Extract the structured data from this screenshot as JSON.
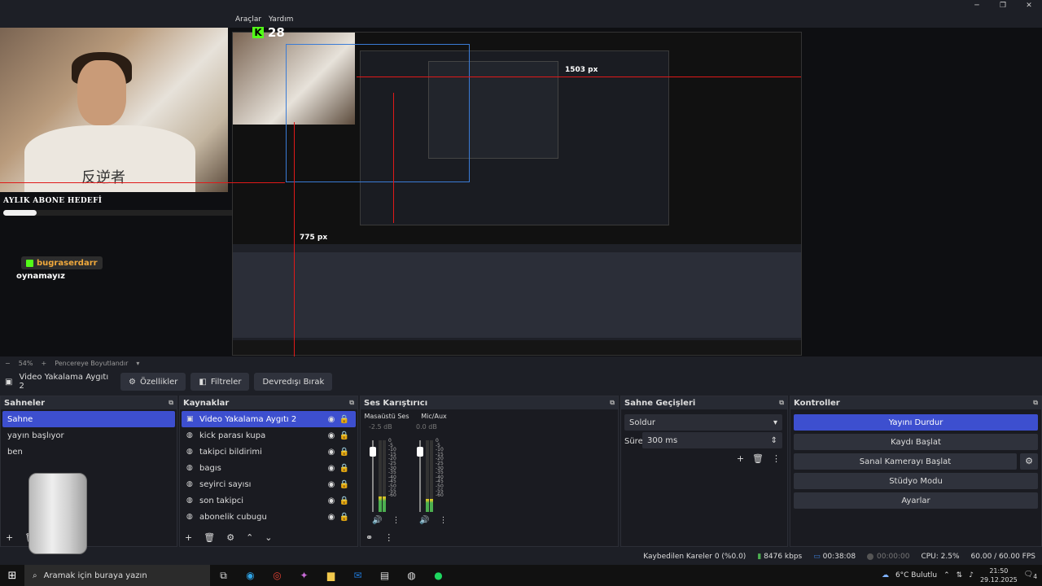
{
  "menu": {
    "items": [
      "Araçlar",
      "Yardım"
    ]
  },
  "window_controls": {
    "minimize": "─",
    "maximize": "❐",
    "close": "✕"
  },
  "preview": {
    "goal_label": "AYLIK ABONE HEDEFİ",
    "goal_progress": 0.12,
    "follower_name": "bugraserdarr",
    "follower_msg": "oynamayız",
    "kick_count": "28",
    "kick_k": "K",
    "shirt_text": "反逆者",
    "px_right": "1503 px",
    "px_bottom": "775 px"
  },
  "preview_bar": {
    "minus": "−",
    "zoom": "54%",
    "plus": "+",
    "fit": "Pencereye Boyutlandır",
    "chevron": "▾"
  },
  "source_toolbar": {
    "source_name": "Video Yakalama Aygıtı 2",
    "properties": "Özellikler",
    "filters": "Filtreler",
    "deactivate": "Devredışı Bırak"
  },
  "scenes": {
    "title": "Sahneler",
    "items": [
      "Sahne",
      "yayın başlıyor",
      "ben"
    ],
    "selected": 0
  },
  "sources": {
    "title": "Kaynaklar",
    "items": [
      {
        "label": "Video Yakalama Aygıtı 2",
        "icon": "camera-icon"
      },
      {
        "label": "kick parası kupa",
        "icon": "globe-icon"
      },
      {
        "label": "takipci bildirimi",
        "icon": "globe-icon"
      },
      {
        "label": "bagıs",
        "icon": "globe-icon"
      },
      {
        "label": "seyirci sayısı",
        "icon": "globe-icon"
      },
      {
        "label": "son takipci",
        "icon": "globe-icon"
      },
      {
        "label": "abonelik cubugu",
        "icon": "globe-icon"
      }
    ]
  },
  "mixer": {
    "title": "Ses Karıştırıcı",
    "channels": [
      {
        "name": "Masaüstü Ses",
        "db": "-2.5 dB",
        "level": 0.22
      },
      {
        "name": "Mic/Aux",
        "db": "0.0 dB",
        "level": 0.18
      }
    ],
    "scale": [
      "0",
      "-5",
      "-10",
      "-15",
      "-20",
      "-25",
      "-30",
      "-35",
      "-40",
      "-45",
      "-50",
      "-55",
      "-60"
    ]
  },
  "transitions": {
    "title": "Sahne Geçişleri",
    "selected": "Soldur",
    "duration_label": "Süre",
    "duration_value": "300 ms"
  },
  "controls": {
    "title": "Kontroller",
    "stop_stream": "Yayını Durdur",
    "start_record": "Kaydı Başlat",
    "start_vcam": "Sanal Kamerayı Başlat",
    "studio_mode": "Stüdyo Modu",
    "settings": "Ayarlar"
  },
  "status": {
    "dropped": "Kaybedilen Kareler 0 (%0.0)",
    "bitrate": "8476 kbps",
    "stream_time": "00:38:08",
    "rec_time": "00:00:00",
    "cpu": "CPU: 2.5%",
    "fps": "60.00 / 60.00 FPS"
  },
  "taskbar": {
    "search_placeholder": "Aramak için buraya yazın",
    "weather": "6°C  Bulutlu",
    "time": "21:50",
    "date": "29.12.2025",
    "notifications": "4"
  },
  "colors": {
    "accent": "#3d4fcf",
    "kick_green": "#53fc18",
    "red_guide": "#e01919"
  }
}
